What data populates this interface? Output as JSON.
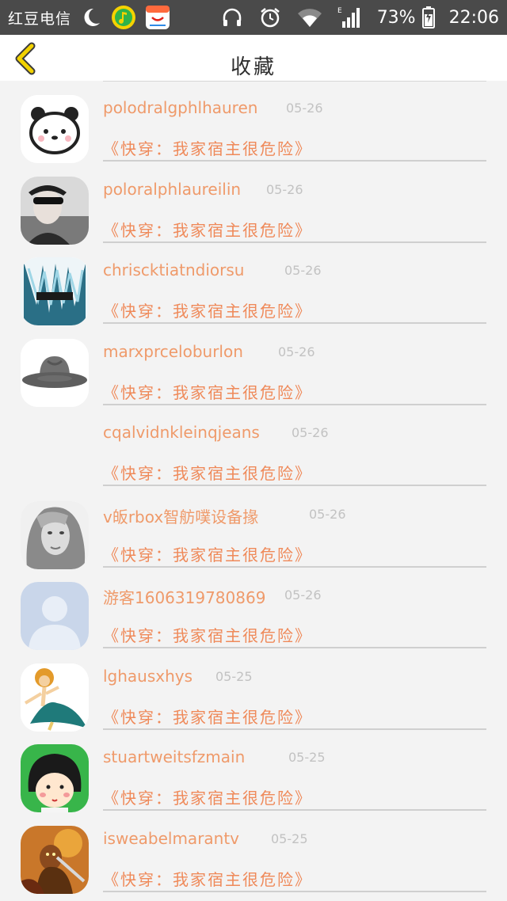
{
  "status_bar": {
    "carrier": "红豆电信",
    "battery": "73%",
    "time": "22:06",
    "signal_label": "E"
  },
  "header": {
    "title": "收藏"
  },
  "favorites": [
    {
      "user": "polodralgphlhauren",
      "date": "05-26",
      "work": "《快穿：我家宿主很危险》",
      "avatar": "panda-face-icon"
    },
    {
      "user": "poloralphlaureilin",
      "date": "05-26",
      "work": "《快穿：我家宿主很危险》",
      "avatar": "person-sunglasses-avatar"
    },
    {
      "user": "chrisсktiatndiorsu",
      "date": "05-26",
      "work": "《快穿：我家宿主很危险》",
      "avatar": "anime-blue-hair-avatar"
    },
    {
      "user": "marxprceloburlon",
      "date": "05-26",
      "work": "《快穿：我家宿主很危险》",
      "avatar": "fedora-hat-avatar"
    },
    {
      "user": "cqalvidnkleinqjeans",
      "date": "05-26",
      "work": "《快穿：我家宿主很危险》",
      "avatar": ""
    },
    {
      "user": "v皈rbox智舫噗设备掾",
      "date": "05-26",
      "work": "《快穿：我家宿主很危险》",
      "avatar": "woman-portrait-avatar"
    },
    {
      "user": "游客1606319780869",
      "date": "05-26",
      "work": "《快穿：我家宿主很危险》",
      "avatar": "default-user-avatar"
    },
    {
      "user": "lghausxhys",
      "date": "05-25",
      "work": "《快穿：我家宿主很危险》",
      "avatar": "dancing-cartoon-avatar"
    },
    {
      "user": "stuartweitsfzmain",
      "date": "05-25",
      "work": "《快穿：我家宿主很危险》",
      "avatar": "cartoon-girl-avatar"
    },
    {
      "user": "isweabelmarantv",
      "date": "05-25",
      "work": "《快穿：我家宿主很危险》",
      "avatar": "warrior-game-avatar"
    }
  ],
  "colors": {
    "accent": "#ef9a6a",
    "back_arrow": "#f2d200"
  }
}
